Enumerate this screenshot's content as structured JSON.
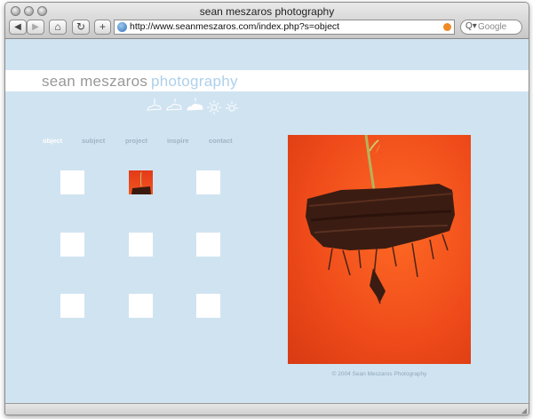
{
  "browser": {
    "title": "sean meszaros photography",
    "url": "http://www.seanmeszaros.com/index.php?s=object",
    "search_placeholder": "Google",
    "back_glyph": "◀",
    "forward_glyph": "▶",
    "home_glyph": "⌂",
    "reload_glyph": "↻",
    "add_glyph": "+",
    "search_glyph": "Q▾"
  },
  "site": {
    "brand_primary": "sean meszaros",
    "brand_secondary": "photography",
    "nav": [
      {
        "label": "object",
        "active": true
      },
      {
        "label": "subject",
        "active": false
      },
      {
        "label": "project",
        "active": false
      },
      {
        "label": "inspire",
        "active": false
      },
      {
        "label": "contact",
        "active": false
      }
    ],
    "weather_icons": [
      "cloud-arrow-icon",
      "cloud-icon",
      "cloudy-icon",
      "sun-icon",
      "sun-partial-icon"
    ],
    "thumbnails": 9,
    "selected_thumbnail": 2,
    "main_photo": "plant-roots-photo",
    "copyright": "© 2004 Sean Meszaros Photography"
  },
  "colors": {
    "page_bg": "#d0e3f1",
    "brand_primary": "#999999",
    "brand_secondary": "#aed0ea",
    "nav_inactive": "#9fb4c4",
    "nav_active": "#ffffff",
    "photo_bg": "#ee4a1a"
  }
}
